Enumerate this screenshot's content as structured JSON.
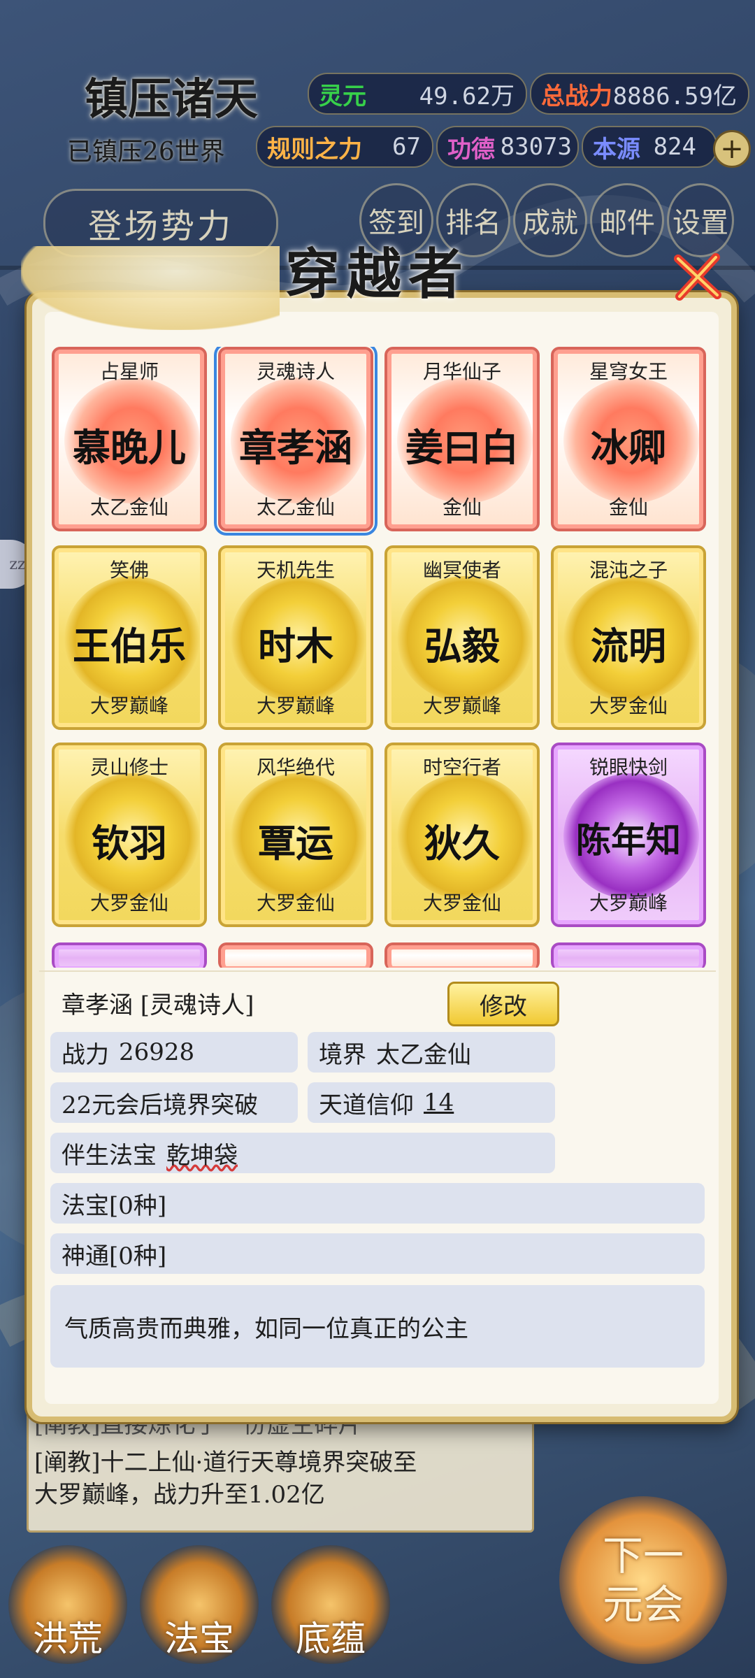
{
  "hud": {
    "title": "镇压诸天",
    "subtitle": "已镇压26世界",
    "stats": [
      {
        "label": "灵元",
        "value": "49.62万",
        "label_color": "#37d04a"
      },
      {
        "label": "总战力",
        "value": "8886.59亿",
        "label_color": "#ff6a3a"
      },
      {
        "label": "规则之力",
        "value": "67",
        "label_color": "#ffb347"
      },
      {
        "label": "功德",
        "value": "83073",
        "label_color": "#e060c8"
      },
      {
        "label": "本源",
        "value": "824",
        "label_color": "#7a8cff"
      }
    ],
    "plus_icon": "+",
    "faction_button": "登场势力",
    "circle_buttons": [
      "签到",
      "排名",
      "成就",
      "邮件",
      "设置"
    ]
  },
  "modal": {
    "title": "穿越者",
    "close_icon": "close-x-icon",
    "cards": [
      {
        "title": "占星师",
        "name": "慕晚儿",
        "rank": "太乙金仙",
        "style": "red"
      },
      {
        "title": "灵魂诗人",
        "name": "章孝涵",
        "rank": "太乙金仙",
        "style": "red",
        "selected": true
      },
      {
        "title": "月华仙子",
        "name": "姜曰白",
        "rank": "金仙",
        "style": "red"
      },
      {
        "title": "星穹女王",
        "name": "冰卿",
        "rank": "金仙",
        "style": "red"
      },
      {
        "title": "笑佛",
        "name": "王伯乐",
        "rank": "大罗巅峰",
        "style": "gold"
      },
      {
        "title": "天机先生",
        "name": "时木",
        "rank": "大罗巅峰",
        "style": "gold"
      },
      {
        "title": "幽冥使者",
        "name": "弘毅",
        "rank": "大罗巅峰",
        "style": "gold"
      },
      {
        "title": "混沌之子",
        "name": "流明",
        "rank": "大罗金仙",
        "style": "gold"
      },
      {
        "title": "灵山修士",
        "name": "钦羽",
        "rank": "大罗金仙",
        "style": "gold"
      },
      {
        "title": "风华绝代",
        "name": "覃运",
        "rank": "大罗金仙",
        "style": "gold"
      },
      {
        "title": "时空行者",
        "name": "狄久",
        "rank": "大罗金仙",
        "style": "gold"
      },
      {
        "title": "锐眼快剑",
        "name": "陈年知",
        "rank": "大罗巅峰",
        "style": "purple"
      }
    ],
    "detail": {
      "name_line": "章孝涵 [灵魂诗人]",
      "edit_button": "修改",
      "power_label": "战力",
      "power_value": "26928",
      "realm_label": "境界",
      "realm_value": "太乙金仙",
      "breakthrough": "22元会后境界突破",
      "faith_label": "天道信仰",
      "faith_value": "14",
      "treasure_label": "伴生法宝",
      "treasure_value": "乾坤袋",
      "treasures": "法宝[0种]",
      "abilities": "神通[0种]",
      "description": "气质高贵而典雅，如同一位真正的公主"
    }
  },
  "log": {
    "lines": [
      "[阐教]直接炼化了一份虚空碎片",
      "[阐教]十二上仙·道行天尊境界突破至",
      "大罗巅峰，战力升至1.02亿"
    ]
  },
  "bottom_nav": [
    "洪荒",
    "法宝",
    "底蕴"
  ],
  "next_button": [
    "下一",
    "元会"
  ],
  "side_tab": "zz"
}
